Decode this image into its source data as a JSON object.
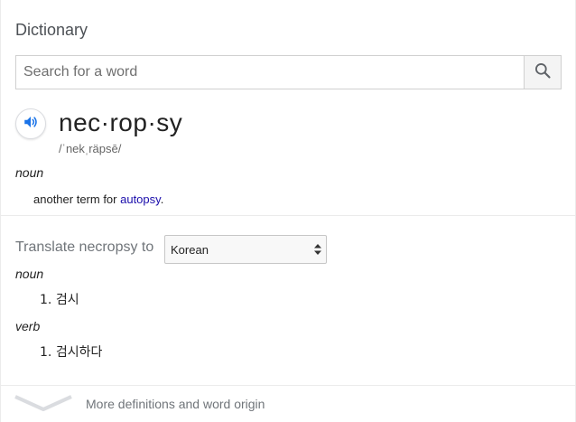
{
  "header": {
    "title": "Dictionary"
  },
  "search": {
    "placeholder": "Search for a word",
    "value": ""
  },
  "entry": {
    "word": "nec·rop·sy",
    "phonetic": "/ˈnekˌräpsē/",
    "part_of_speech": "noun",
    "definition_prefix": "another term for ",
    "definition_link": "autopsy",
    "definition_suffix": "."
  },
  "translate": {
    "label": "Translate necropsy to",
    "selected_language": "Korean",
    "groups": [
      {
        "pos": "noun",
        "items": [
          {
            "num": "1.",
            "text": "검시"
          }
        ]
      },
      {
        "pos": "verb",
        "items": [
          {
            "num": "1.",
            "text": "검시하다"
          }
        ]
      }
    ]
  },
  "footer": {
    "more_label": "More definitions and word origin"
  },
  "colors": {
    "accent": "#1a73e8",
    "link": "#1a0dab",
    "muted": "#70757a"
  },
  "icons": {
    "search": "search-icon",
    "speaker": "speaker-icon",
    "dropdown": "updown-arrows-icon",
    "expand": "chevron-down-icon"
  }
}
